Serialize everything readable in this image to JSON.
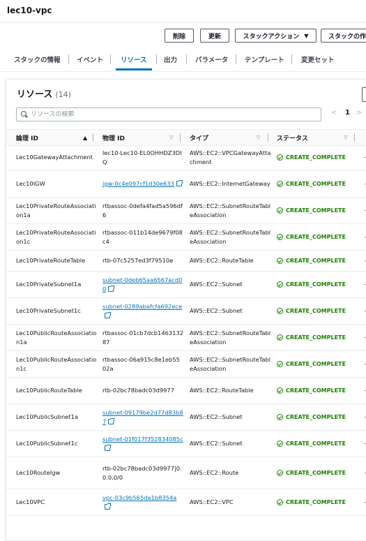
{
  "page": {
    "title": "lec10-vpc"
  },
  "actions": {
    "delete": "削除",
    "update": "更新",
    "stack_actions": "スタックアクション",
    "create_stack": "スタックの作成"
  },
  "tabs": [
    {
      "label": "スタックの情報"
    },
    {
      "label": "イベント"
    },
    {
      "label": "リソース",
      "active": true
    },
    {
      "label": "出力"
    },
    {
      "label": "パラメータ"
    },
    {
      "label": "テンプレート"
    },
    {
      "label": "変更セット"
    }
  ],
  "resources": {
    "title": "リソース",
    "count": "(14)",
    "search_placeholder": "リソースの検索",
    "page": "1",
    "columns": {
      "logical": "論理 ID",
      "physical": "物理 ID",
      "type": "タイプ",
      "status": "ステータス"
    },
    "status_color": "#1d8102",
    "link_color": "#0073bb",
    "rows": [
      {
        "logical": "Lec10GatewayAttachment",
        "physical": "lec10-Lec10-EL0OHHDZ3DIQ",
        "link": false,
        "type": "AWS::EC2::VPCGatewayAttachment",
        "status": "CREATE_COMPLETE",
        "extra": "-"
      },
      {
        "logical": "Lec10IGW",
        "physical": "igw-0c4e097cf1d30e633",
        "link": true,
        "type": "AWS::EC2::InternetGateway",
        "status": "CREATE_COMPLETE",
        "extra": "-"
      },
      {
        "logical": "Lec10PrivateRouteAssociation1a",
        "physical": "rtbassoc-0defa4fad5a596df6",
        "link": false,
        "type": "AWS::EC2::SubnetRouteTableAssociation",
        "status": "CREATE_COMPLETE",
        "extra": "-"
      },
      {
        "logical": "Lec10PrivateRouteAssociation1c",
        "physical": "rtbassoc-011b14de9679f08c4",
        "link": false,
        "type": "AWS::EC2::SubnetRouteTableAssociation",
        "status": "CREATE_COMPLETE",
        "extra": "-"
      },
      {
        "logical": "Lec10PrivateRouteTable",
        "physical": "rtb-07c5257ed3f79510e",
        "link": false,
        "type": "AWS::EC2::RouteTable",
        "status": "CREATE_COMPLETE",
        "extra": "-"
      },
      {
        "logical": "Lec10PrivateSubnet1a",
        "physical": "subnet-0deb65aa6567acd00",
        "link": true,
        "type": "AWS::EC2::Subnet",
        "status": "CREATE_COMPLETE",
        "extra": "-"
      },
      {
        "logical": "Lec10PrivateSubnet1c",
        "physical": "subnet-0289abafcfa692ece",
        "link": true,
        "type": "AWS::EC2::Subnet",
        "status": "CREATE_COMPLETE",
        "extra": "-"
      },
      {
        "logical": "Lec10PublicRouteAssociation1a",
        "physical": "rtbassoc-01cb7dcb146313287",
        "link": false,
        "type": "AWS::EC2::SubnetRouteTableAssociation",
        "status": "CREATE_COMPLETE",
        "extra": "-"
      },
      {
        "logical": "Lec10PublicRouteAssociation1c",
        "physical": "rtbassoc-06a915c8e1eb5502a",
        "link": false,
        "type": "AWS::EC2::SubnetRouteTableAssociation",
        "status": "CREATE_COMPLETE",
        "extra": "-"
      },
      {
        "logical": "Lec10PublicRouteTable",
        "physical": "rtb-02bc78badc03d9977",
        "link": false,
        "type": "AWS::EC2::RouteTable",
        "status": "CREATE_COMPLETE",
        "extra": "-"
      },
      {
        "logical": "Lec10PublicSubnet1a",
        "physical": "subnet-09179be2d77d83b87",
        "link": true,
        "type": "AWS::EC2::Subnet",
        "status": "CREATE_COMPLETE",
        "extra": "-"
      },
      {
        "logical": "Lec10PublicSubnet1c",
        "physical": "subnet-01f017f352834085c",
        "link": true,
        "type": "AWS::EC2::Subnet",
        "status": "CREATE_COMPLETE",
        "extra": "-"
      },
      {
        "logical": "Lec10RouteIgw",
        "physical": "rtb-02bc78badc03d9977|0.0.0.0/0",
        "link": false,
        "type": "AWS::EC2::Route",
        "status": "CREATE_COMPLETE",
        "extra": "-"
      },
      {
        "logical": "Lec10VPC",
        "physical": "vpc-03c9b565da1b8354a",
        "link": true,
        "type": "AWS::EC2::VPC",
        "status": "CREATE_COMPLETE",
        "extra": "-"
      }
    ]
  }
}
